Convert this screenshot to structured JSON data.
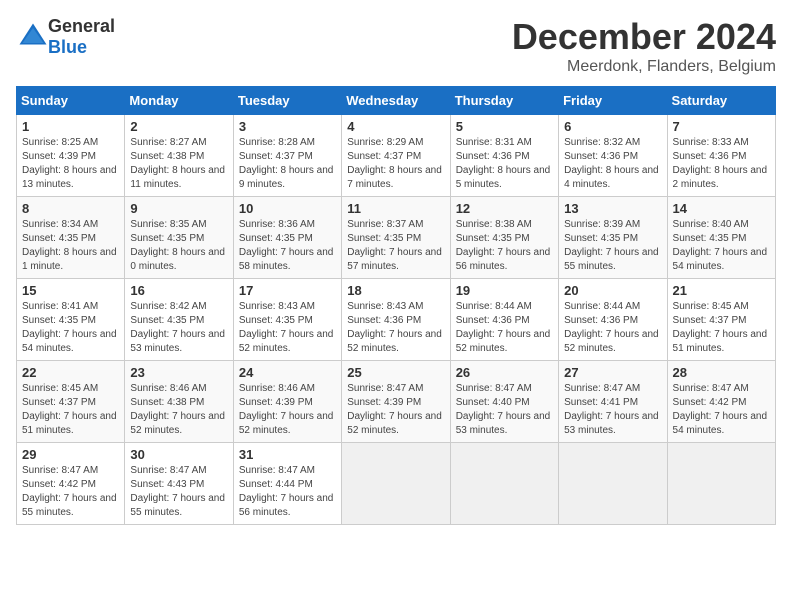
{
  "logo": {
    "general": "General",
    "blue": "Blue"
  },
  "title": "December 2024",
  "location": "Meerdonk, Flanders, Belgium",
  "days_of_week": [
    "Sunday",
    "Monday",
    "Tuesday",
    "Wednesday",
    "Thursday",
    "Friday",
    "Saturday"
  ],
  "weeks": [
    [
      {
        "day": "1",
        "sunrise": "8:25 AM",
        "sunset": "4:39 PM",
        "daylight": "8 hours and 13 minutes."
      },
      {
        "day": "2",
        "sunrise": "8:27 AM",
        "sunset": "4:38 PM",
        "daylight": "8 hours and 11 minutes."
      },
      {
        "day": "3",
        "sunrise": "8:28 AM",
        "sunset": "4:37 PM",
        "daylight": "8 hours and 9 minutes."
      },
      {
        "day": "4",
        "sunrise": "8:29 AM",
        "sunset": "4:37 PM",
        "daylight": "8 hours and 7 minutes."
      },
      {
        "day": "5",
        "sunrise": "8:31 AM",
        "sunset": "4:36 PM",
        "daylight": "8 hours and 5 minutes."
      },
      {
        "day": "6",
        "sunrise": "8:32 AM",
        "sunset": "4:36 PM",
        "daylight": "8 hours and 4 minutes."
      },
      {
        "day": "7",
        "sunrise": "8:33 AM",
        "sunset": "4:36 PM",
        "daylight": "8 hours and 2 minutes."
      }
    ],
    [
      {
        "day": "8",
        "sunrise": "8:34 AM",
        "sunset": "4:35 PM",
        "daylight": "8 hours and 1 minute."
      },
      {
        "day": "9",
        "sunrise": "8:35 AM",
        "sunset": "4:35 PM",
        "daylight": "8 hours and 0 minutes."
      },
      {
        "day": "10",
        "sunrise": "8:36 AM",
        "sunset": "4:35 PM",
        "daylight": "7 hours and 58 minutes."
      },
      {
        "day": "11",
        "sunrise": "8:37 AM",
        "sunset": "4:35 PM",
        "daylight": "7 hours and 57 minutes."
      },
      {
        "day": "12",
        "sunrise": "8:38 AM",
        "sunset": "4:35 PM",
        "daylight": "7 hours and 56 minutes."
      },
      {
        "day": "13",
        "sunrise": "8:39 AM",
        "sunset": "4:35 PM",
        "daylight": "7 hours and 55 minutes."
      },
      {
        "day": "14",
        "sunrise": "8:40 AM",
        "sunset": "4:35 PM",
        "daylight": "7 hours and 54 minutes."
      }
    ],
    [
      {
        "day": "15",
        "sunrise": "8:41 AM",
        "sunset": "4:35 PM",
        "daylight": "7 hours and 54 minutes."
      },
      {
        "day": "16",
        "sunrise": "8:42 AM",
        "sunset": "4:35 PM",
        "daylight": "7 hours and 53 minutes."
      },
      {
        "day": "17",
        "sunrise": "8:43 AM",
        "sunset": "4:35 PM",
        "daylight": "7 hours and 52 minutes."
      },
      {
        "day": "18",
        "sunrise": "8:43 AM",
        "sunset": "4:36 PM",
        "daylight": "7 hours and 52 minutes."
      },
      {
        "day": "19",
        "sunrise": "8:44 AM",
        "sunset": "4:36 PM",
        "daylight": "7 hours and 52 minutes."
      },
      {
        "day": "20",
        "sunrise": "8:44 AM",
        "sunset": "4:36 PM",
        "daylight": "7 hours and 52 minutes."
      },
      {
        "day": "21",
        "sunrise": "8:45 AM",
        "sunset": "4:37 PM",
        "daylight": "7 hours and 51 minutes."
      }
    ],
    [
      {
        "day": "22",
        "sunrise": "8:45 AM",
        "sunset": "4:37 PM",
        "daylight": "7 hours and 51 minutes."
      },
      {
        "day": "23",
        "sunrise": "8:46 AM",
        "sunset": "4:38 PM",
        "daylight": "7 hours and 52 minutes."
      },
      {
        "day": "24",
        "sunrise": "8:46 AM",
        "sunset": "4:39 PM",
        "daylight": "7 hours and 52 minutes."
      },
      {
        "day": "25",
        "sunrise": "8:47 AM",
        "sunset": "4:39 PM",
        "daylight": "7 hours and 52 minutes."
      },
      {
        "day": "26",
        "sunrise": "8:47 AM",
        "sunset": "4:40 PM",
        "daylight": "7 hours and 53 minutes."
      },
      {
        "day": "27",
        "sunrise": "8:47 AM",
        "sunset": "4:41 PM",
        "daylight": "7 hours and 53 minutes."
      },
      {
        "day": "28",
        "sunrise": "8:47 AM",
        "sunset": "4:42 PM",
        "daylight": "7 hours and 54 minutes."
      }
    ],
    [
      {
        "day": "29",
        "sunrise": "8:47 AM",
        "sunset": "4:42 PM",
        "daylight": "7 hours and 55 minutes."
      },
      {
        "day": "30",
        "sunrise": "8:47 AM",
        "sunset": "4:43 PM",
        "daylight": "7 hours and 55 minutes."
      },
      {
        "day": "31",
        "sunrise": "8:47 AM",
        "sunset": "4:44 PM",
        "daylight": "7 hours and 56 minutes."
      },
      null,
      null,
      null,
      null
    ]
  ]
}
